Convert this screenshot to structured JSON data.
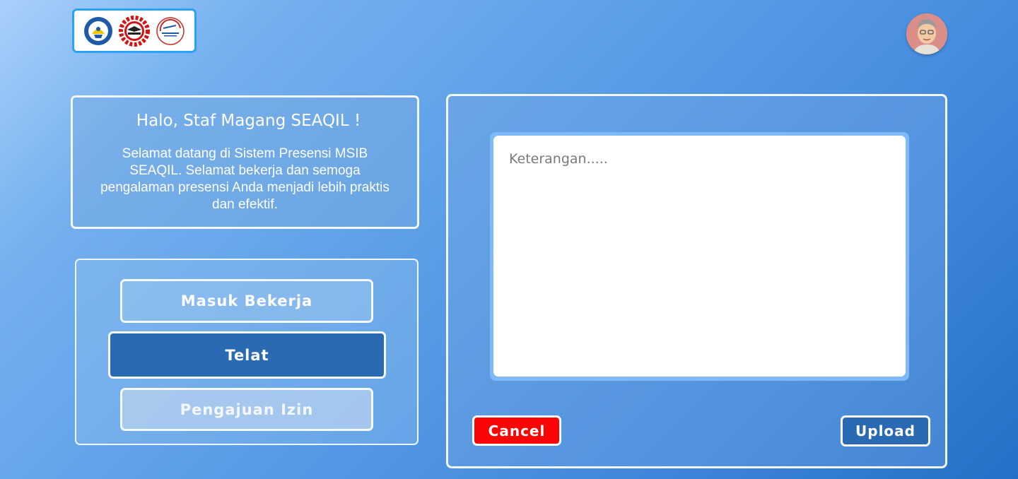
{
  "header": {
    "logos": [
      "kemendikbud-logo",
      "seameo-logo",
      "seameo-qitep-language-logo"
    ],
    "avatar_icon": "user-avatar-icon"
  },
  "welcome": {
    "title": "Halo, Staf Magang SEAQIL !",
    "text": "Selamat datang di Sistem Presensi MSIB SEAQIL. Selamat bekerja dan semoga pengalaman presensi Anda menjadi lebih praktis dan efektif."
  },
  "menu": {
    "masuk_label": "Masuk Bekerja",
    "telat_label": "Telat",
    "izin_label": "Pengajuan Izin"
  },
  "form": {
    "placeholder": "Keterangan.....",
    "cancel_label": "Cancel",
    "upload_label": "Upload"
  },
  "colors": {
    "active": "#2a6ab2",
    "cancel": "#fa0505",
    "logo_border": "#29a3f5"
  }
}
